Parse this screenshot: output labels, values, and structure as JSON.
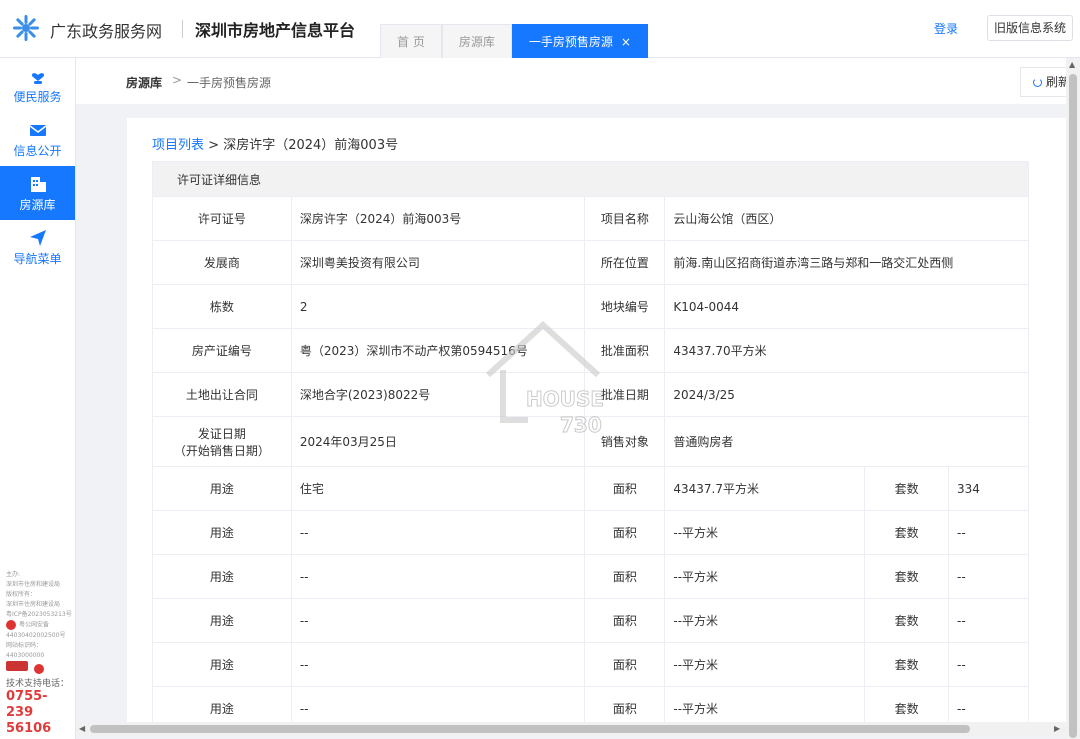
{
  "header": {
    "brand": "广东政务服务网",
    "platform": "深圳市房地产信息平台",
    "tabs": [
      {
        "label": "首 页"
      },
      {
        "label": "房源库"
      },
      {
        "label": "一手房预售房源",
        "close": "×"
      }
    ],
    "login": "登录",
    "old_system": "旧版信息系统"
  },
  "sidebar": {
    "items": [
      {
        "label": "便民服务",
        "icon": "heart-hand-icon"
      },
      {
        "label": "信息公开",
        "icon": "mail-icon"
      },
      {
        "label": "房源库",
        "icon": "building-icon"
      },
      {
        "label": "导航菜单",
        "icon": "send-icon"
      }
    ],
    "footer": {
      "line1": "主办:",
      "line2": "深圳市住房和建设局",
      "line3": "版权所有：",
      "line4": "深圳市住房和建设局",
      "line5": "粤ICP备2023053213号",
      "line6": "粤公网安备",
      "line7": "44030402002500号",
      "line8": "网站标识码：",
      "line9": "4403000000",
      "tel_label": "技术支持电话：",
      "tel_1": "0755-239",
      "tel_2": "56106"
    }
  },
  "breadcrumb": {
    "root": "房源库",
    "sep": ">",
    "current": "一手房预售房源",
    "refresh": "刷新"
  },
  "detail": {
    "crumb_link": "项目列表",
    "crumb_sep": ">",
    "crumb_current": "深房许字（2024）前海003号",
    "table_title": "许可证详细信息",
    "rows": [
      {
        "l1": "许可证号",
        "v1": "深房许字（2024）前海003号",
        "l2": "项目名称",
        "v2": "云山海公馆（西区）"
      },
      {
        "l1": "发展商",
        "v1": "深圳粤美投资有限公司",
        "l2": "所在位置",
        "v2": "前海.南山区招商街道赤湾三路与郑和一路交汇处西侧"
      },
      {
        "l1": "栋数",
        "v1": "2",
        "l2": "地块编号",
        "v2": "K104-0044"
      },
      {
        "l1": "房产证编号",
        "v1": "粤（2023）深圳市不动产权第0594516号",
        "l2": "批准面积",
        "v2": "43437.70平方米"
      },
      {
        "l1": "土地出让合同",
        "v1": "深地合字(2023)8022号",
        "l2": "批准日期",
        "v2": "2024/3/25"
      },
      {
        "l1": "发证日期",
        "l1b": "（开始销售日期）",
        "v1": "2024年03月25日",
        "l2": "销售对象",
        "v2": "普通购房者"
      }
    ],
    "usage_rows": [
      {
        "use_label": "用途",
        "use": "住宅",
        "area_label": "面积",
        "area": "43437.7平方米",
        "units_label": "套数",
        "units": "334"
      },
      {
        "use_label": "用途",
        "use": "--",
        "area_label": "面积",
        "area": "--平方米",
        "units_label": "套数",
        "units": "--"
      },
      {
        "use_label": "用途",
        "use": "--",
        "area_label": "面积",
        "area": "--平方米",
        "units_label": "套数",
        "units": "--"
      },
      {
        "use_label": "用途",
        "use": "--",
        "area_label": "面积",
        "area": "--平方米",
        "units_label": "套数",
        "units": "--"
      },
      {
        "use_label": "用途",
        "use": "--",
        "area_label": "面积",
        "area": "--平方米",
        "units_label": "套数",
        "units": "--"
      },
      {
        "use_label": "用途",
        "use": "--",
        "area_label": "面积",
        "area": "--平方米",
        "units_label": "套数",
        "units": "--"
      }
    ]
  },
  "watermark": {
    "line1": "HOUSE",
    "line2": "730"
  },
  "colors": {
    "accent": "#1677ff",
    "phone": "#e03c3c"
  }
}
